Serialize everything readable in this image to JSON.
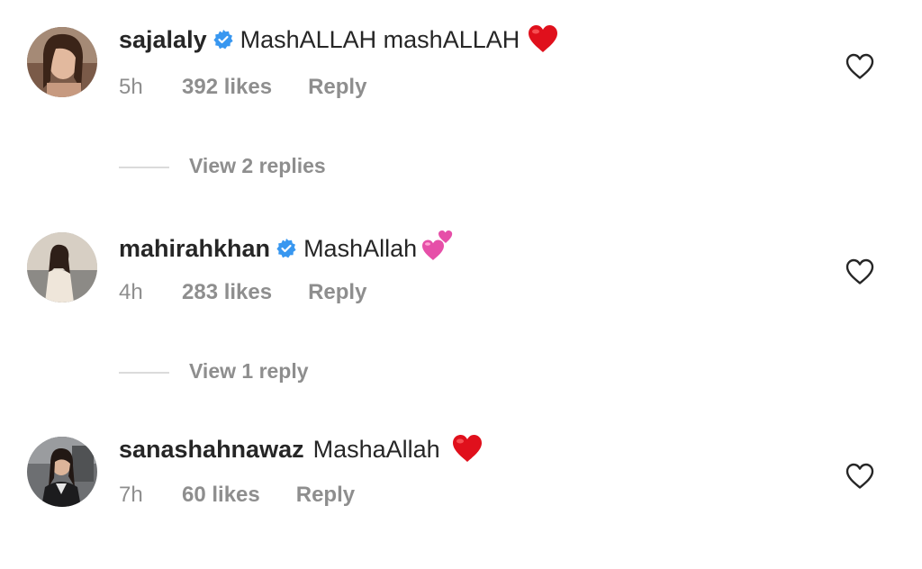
{
  "comments": [
    {
      "username": "sajalaly",
      "verified": true,
      "text": "MashALLAH mashALLAH",
      "emoji": "red-heart",
      "time": "5h",
      "likes": "392 likes",
      "reply_label": "Reply",
      "view_replies": "View 2 replies",
      "avatar_icon": "avatar-photo"
    },
    {
      "username": "mahirahkhan",
      "verified": true,
      "text": "MashAllah",
      "emoji": "two-hearts",
      "time": "4h",
      "likes": "283 likes",
      "reply_label": "Reply",
      "view_replies": "View 1 reply",
      "avatar_icon": "avatar-photo"
    },
    {
      "username": "sanashahnawaz",
      "verified": false,
      "text": "MashaAllah",
      "emoji": "red-heart",
      "time": "7h",
      "likes": "60 likes",
      "reply_label": "Reply",
      "avatar_icon": "avatar-photo"
    }
  ],
  "colors": {
    "primary_text": "#262626",
    "secondary_text": "#8e8e8e",
    "verified_badge": "#3897f0",
    "divider": "#dbdbdb",
    "heart_emoji": "#e0101c",
    "two_hearts_emoji": "#e64fa8"
  }
}
